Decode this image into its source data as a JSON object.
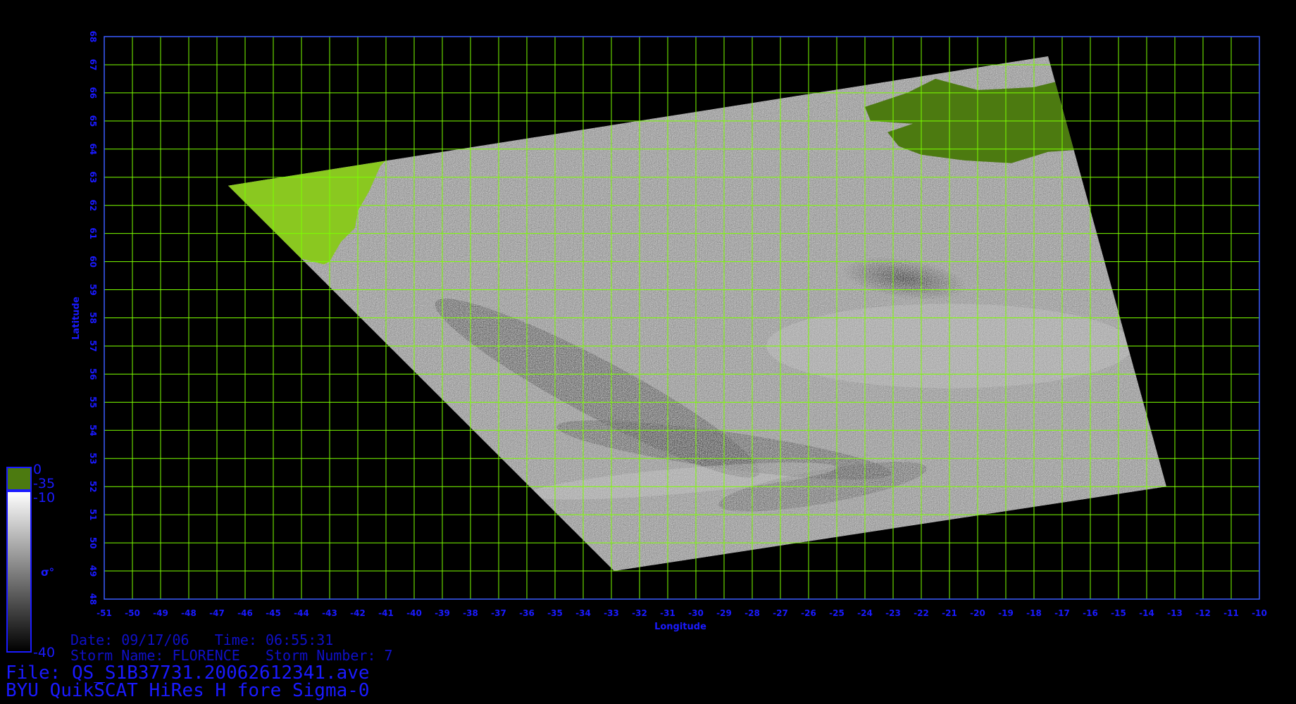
{
  "title": "BYU QuikSCAT HiRes H fore Sigma-0",
  "file": {
    "label": "File:",
    "name": "QS_S1B37731.20062612341.ave"
  },
  "metadata": {
    "date_label": "Date:",
    "date": "09/17/06",
    "time_label": "Time:",
    "time": "06:55:31",
    "storm_name_label": "Storm Name:",
    "storm_name": "FLORENCE",
    "storm_number_label": "Storm Number:",
    "storm_number": "7"
  },
  "colors": {
    "background": "#000000",
    "grid": "#7cff00",
    "axis_text": "#1a1aff",
    "land": "#4c7a10",
    "land_highlight": "#8ac820",
    "swath_dark": "#2e2e2e",
    "swath_light": "#cfcfcf"
  },
  "colorbar": {
    "symbol": "σ°",
    "land_top_label": "0",
    "land_bottom_label": "-35",
    "ocean_top_label": "-10",
    "ocean_bottom_label": "-40",
    "land_color": "#4c7a10",
    "ocean_gradient": [
      "#ffffff",
      "#000000"
    ]
  },
  "map": {
    "x_axis_label": "Longitude",
    "y_axis_label": "Latitude",
    "lon_range": [
      -51,
      -10
    ],
    "lat_range": [
      48,
      68
    ],
    "lon_ticks": [
      -51,
      -50,
      -49,
      -48,
      -47,
      -46,
      -45,
      -44,
      -43,
      -42,
      -41,
      -40,
      -39,
      -38,
      -37,
      -36,
      -35,
      -34,
      -33,
      -32,
      -31,
      -30,
      -29,
      -28,
      -27,
      -26,
      -25,
      -24,
      -23,
      -22,
      -21,
      -20,
      -19,
      -18,
      -17,
      -16,
      -15,
      -14,
      -13,
      -12,
      -11,
      -10
    ],
    "lat_ticks": [
      48,
      49,
      50,
      51,
      52,
      53,
      54,
      55,
      56,
      57,
      58,
      59,
      60,
      61,
      62,
      63,
      64,
      65,
      66,
      67,
      68
    ],
    "grid": true,
    "swath_corners": [
      {
        "lon": -46.6,
        "lat": 62.7
      },
      {
        "lon": -17.5,
        "lat": 67.3
      },
      {
        "lon": -13.3,
        "lat": 52.0
      },
      {
        "lon": -32.9,
        "lat": 49.0
      }
    ],
    "features": [
      {
        "name": "Greenland",
        "type": "land"
      },
      {
        "name": "Iceland",
        "type": "land"
      },
      {
        "name": "Storm low",
        "type": "dark-feature"
      }
    ]
  }
}
